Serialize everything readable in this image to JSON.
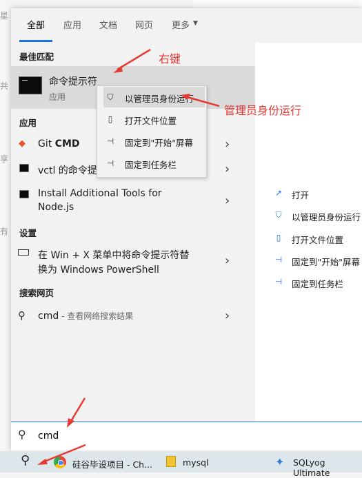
{
  "tabs": [
    "全部",
    "应用",
    "文档",
    "网页",
    "更多"
  ],
  "sections": {
    "best_match": "最佳匹配",
    "apps": "应用",
    "settings": "设置",
    "web": "搜索网页"
  },
  "best_match": {
    "title": "命令提示符",
    "subtitle": "应用"
  },
  "apps": [
    {
      "name": "Git ",
      "bold": "CMD"
    },
    {
      "name": "vctl 的命令提"
    },
    {
      "name": "Install Additional Tools for",
      "name2": "Node.js"
    }
  ],
  "settings_item": {
    "line1": "在 Win + X 菜单中将命令提示符替",
    "line2": "换为 Windows PowerShell"
  },
  "web_item": {
    "query": "cmd",
    "suffix": " - 查看网络搜索结果"
  },
  "context_menu": [
    "以管理员身份运行",
    "打开文件位置",
    "固定到\"开始\"屏幕",
    "固定到任务栏"
  ],
  "right_actions": [
    "打开",
    "以管理员身份运行",
    "打开文件位置",
    "固定到\"开始\"屏幕",
    "固定到任务栏"
  ],
  "search": {
    "value": "cmd"
  },
  "taskbar": [
    "硅谷毕设项目 - Ch...",
    "mysql",
    "SQLyog Ultimate"
  ],
  "annotations": {
    "right_click": "右键",
    "run_as_admin": "管理员身份运行"
  },
  "bg_glyphs": [
    "星",
    "共",
    "享",
    "有"
  ],
  "colors": {
    "accent": "#1a73e8",
    "annotation": "#e53935",
    "highlight": "#dadada"
  }
}
